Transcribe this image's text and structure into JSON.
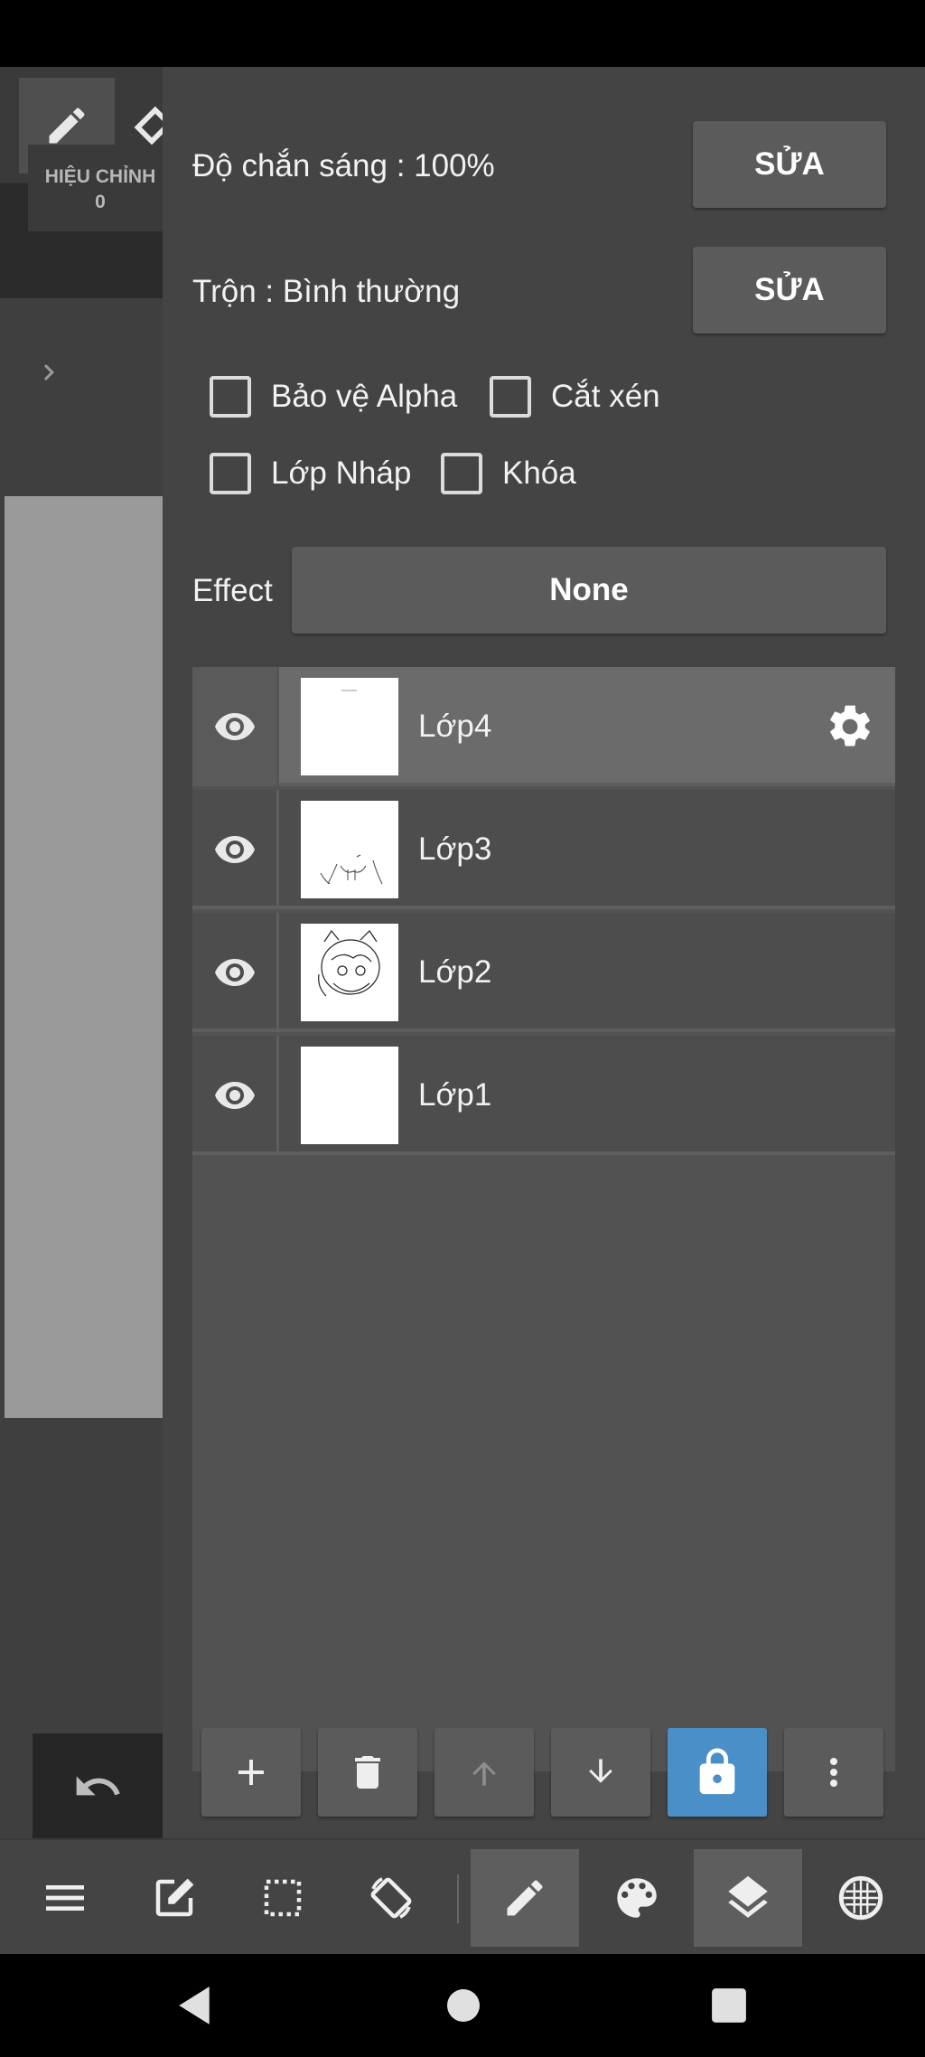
{
  "opacity": {
    "label": "Độ chắn sáng : 100%",
    "edit_label": "SỬA"
  },
  "blend": {
    "label": "Trộn : Bình thường",
    "edit_label": "SỬA"
  },
  "options": {
    "alpha_protect": {
      "label": "Bảo vệ Alpha",
      "checked": false
    },
    "clipping": {
      "label": "Cắt xén",
      "checked": false
    },
    "draft_layer": {
      "label": "Lớp Nháp",
      "checked": false
    },
    "lock": {
      "label": "Khóa",
      "checked": false
    }
  },
  "effect": {
    "label": "Effect",
    "value": "None"
  },
  "layers": [
    {
      "name": "Lớp4",
      "visible": true,
      "selected": true
    },
    {
      "name": "Lớp3",
      "visible": true,
      "selected": false
    },
    {
      "name": "Lớp2",
      "visible": true,
      "selected": false
    },
    {
      "name": "Lớp1",
      "visible": true,
      "selected": false
    }
  ],
  "left_panel": {
    "correction_label": "HIỆU CHỈNH",
    "correction_value": "0"
  },
  "layer_toolbar": [
    "add-icon",
    "trash-icon",
    "arrow-up-icon",
    "arrow-down-icon",
    "lock-icon",
    "more-vert-icon"
  ],
  "bottom_toolbar": [
    "menu-icon",
    "edit-icon",
    "selection-icon",
    "rotate-icon",
    "pen-icon",
    "palette-icon",
    "layers-icon",
    "grid-icon"
  ],
  "colors": {
    "accent": "#4a8fc7",
    "panel": "#444444",
    "button": "#5b5b5b"
  }
}
